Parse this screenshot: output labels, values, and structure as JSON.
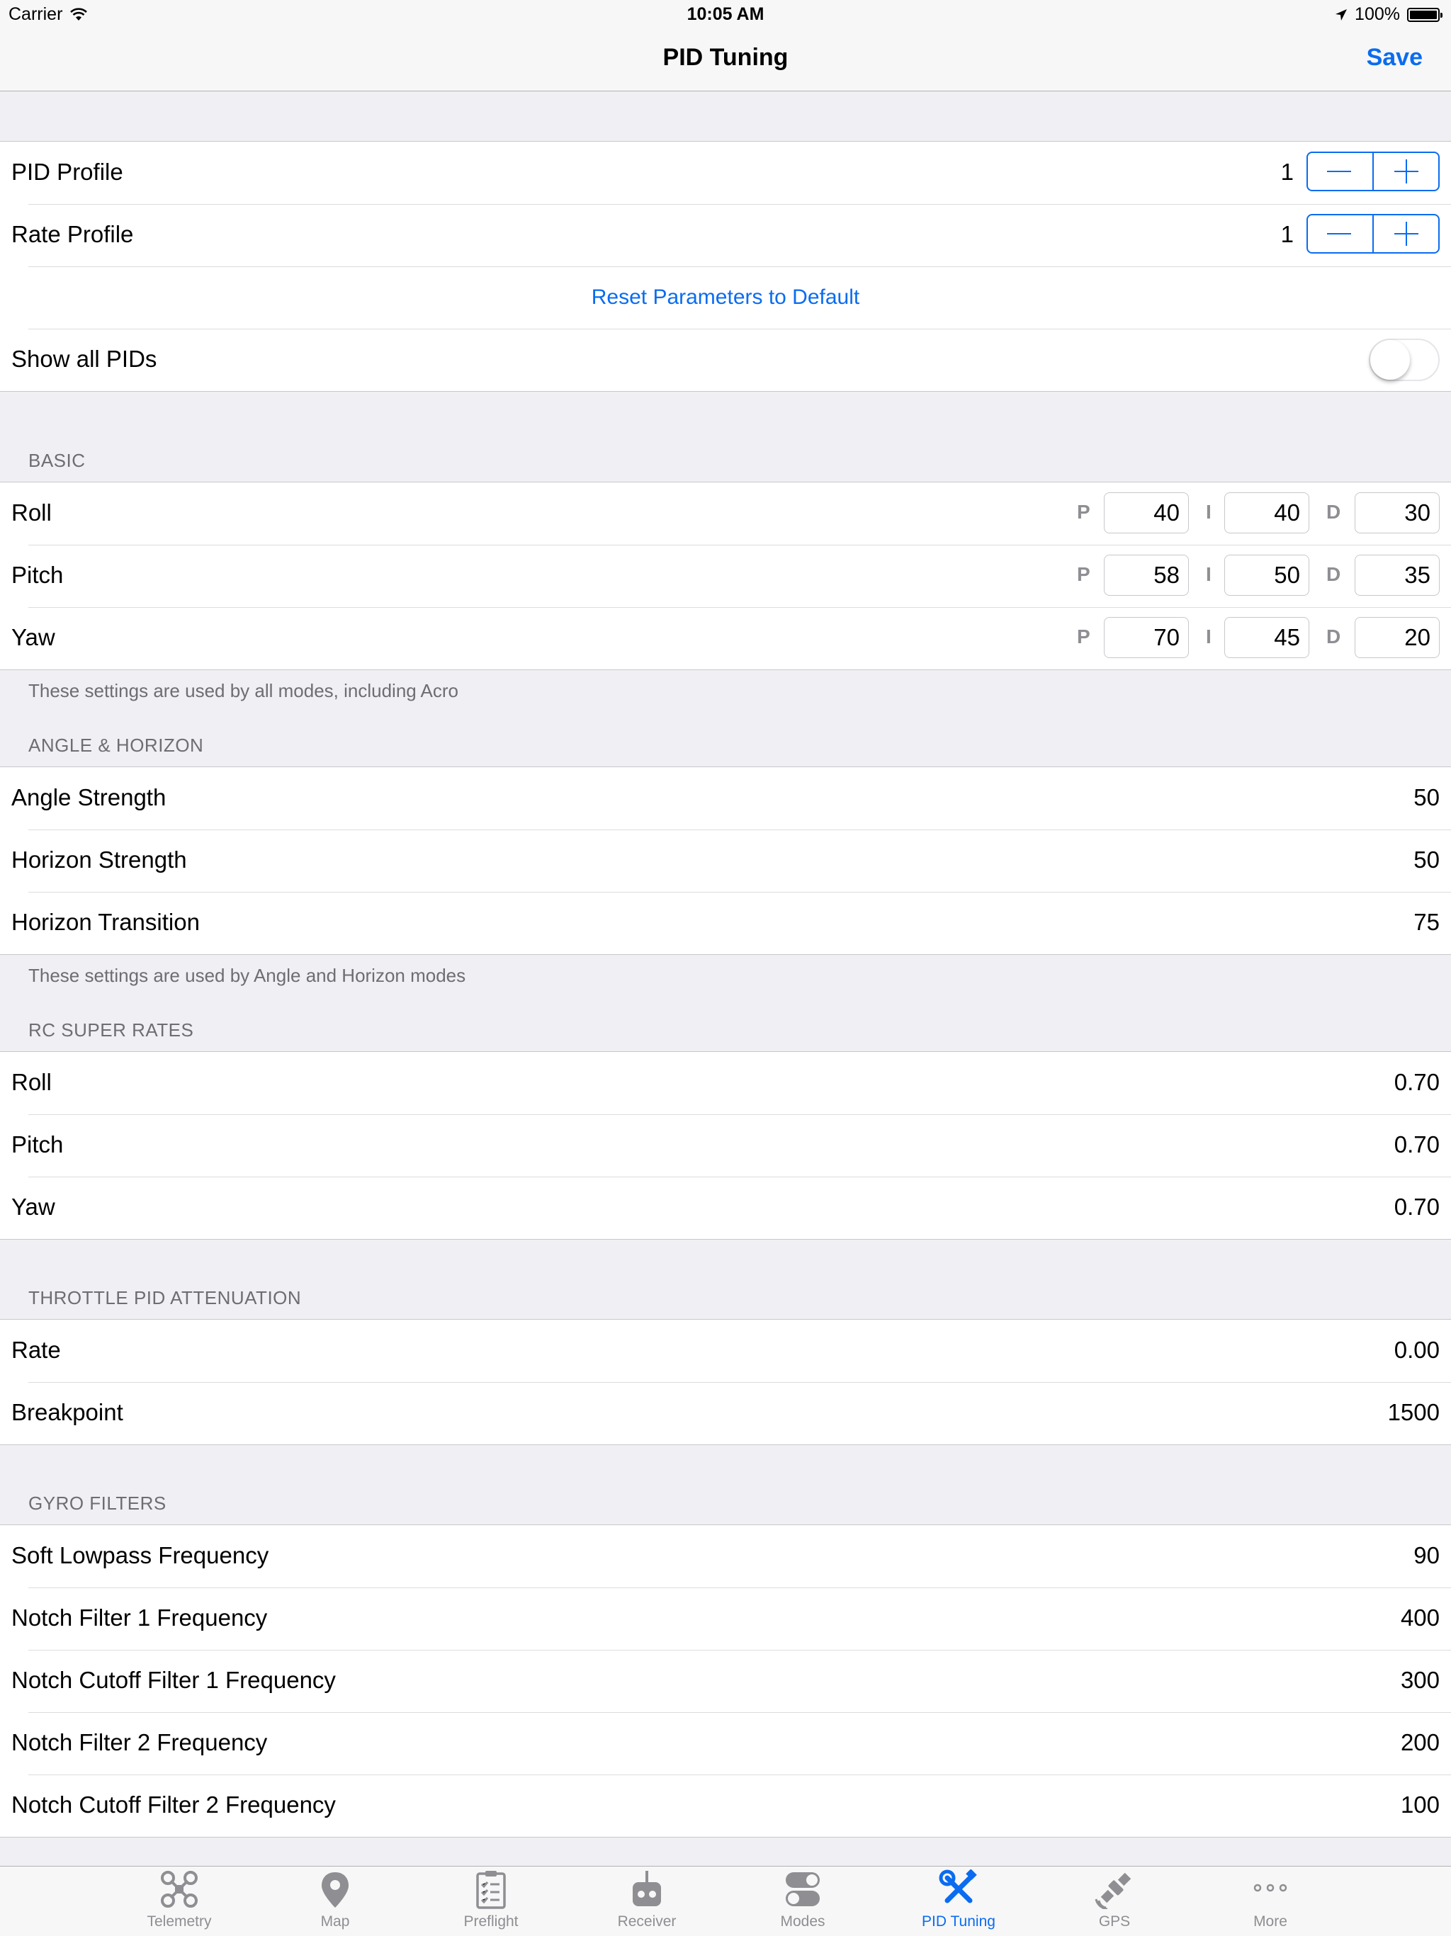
{
  "status_bar": {
    "carrier": "Carrier",
    "time": "10:05 AM",
    "battery": "100%"
  },
  "nav": {
    "title": "PID Tuning",
    "save": "Save"
  },
  "profiles": [
    {
      "label": "PID Profile",
      "value": "1"
    },
    {
      "label": "Rate Profile",
      "value": "1"
    }
  ],
  "reset_label": "Reset Parameters to Default",
  "show_all": {
    "label": "Show all PIDs",
    "on": false
  },
  "letters": {
    "p": "P",
    "i": "I",
    "d": "D"
  },
  "basic": {
    "header": "BASIC",
    "footer": "These settings are used by all modes, including Acro",
    "rows": [
      {
        "label": "Roll",
        "p": "40",
        "i": "40",
        "d": "30"
      },
      {
        "label": "Pitch",
        "p": "58",
        "i": "50",
        "d": "35"
      },
      {
        "label": "Yaw",
        "p": "70",
        "i": "45",
        "d": "20"
      }
    ]
  },
  "angle_horizon": {
    "header": "ANGLE & HORIZON",
    "footer": "These settings are used by Angle and Horizon modes",
    "rows": [
      {
        "label": "Angle Strength",
        "value": "50"
      },
      {
        "label": "Horizon Strength",
        "value": "50"
      },
      {
        "label": "Horizon Transition",
        "value": "75"
      }
    ]
  },
  "rc_super_rates": {
    "header": "RC SUPER RATES",
    "rows": [
      {
        "label": "Roll",
        "value": "0.70"
      },
      {
        "label": "Pitch",
        "value": "0.70"
      },
      {
        "label": "Yaw",
        "value": "0.70"
      }
    ]
  },
  "throttle": {
    "header": "THROTTLE PID ATTENUATION",
    "rows": [
      {
        "label": "Rate",
        "value": "0.00"
      },
      {
        "label": "Breakpoint",
        "value": "1500"
      }
    ]
  },
  "gyro": {
    "header": "GYRO FILTERS",
    "rows": [
      {
        "label": "Soft Lowpass Frequency",
        "value": "90"
      },
      {
        "label": "Notch Filter 1 Frequency",
        "value": "400"
      },
      {
        "label": "Notch Cutoff Filter 1 Frequency",
        "value": "300"
      },
      {
        "label": "Notch Filter 2 Frequency",
        "value": "200"
      },
      {
        "label": "Notch Cutoff Filter 2 Frequency",
        "value": "100"
      }
    ]
  },
  "tabs": [
    {
      "label": "Telemetry",
      "icon": "drone-icon"
    },
    {
      "label": "Map",
      "icon": "map-pin-icon"
    },
    {
      "label": "Preflight",
      "icon": "checklist-icon"
    },
    {
      "label": "Receiver",
      "icon": "receiver-icon"
    },
    {
      "label": "Modes",
      "icon": "toggles-icon"
    },
    {
      "label": "PID Tuning",
      "icon": "wrench-screwdriver-icon",
      "active": true
    },
    {
      "label": "GPS",
      "icon": "satellite-icon"
    },
    {
      "label": "More",
      "icon": "more-icon"
    }
  ],
  "colors": {
    "accent": "#0a6cf0",
    "background": "#efeff4",
    "secondary_text": "#6d6d72"
  }
}
